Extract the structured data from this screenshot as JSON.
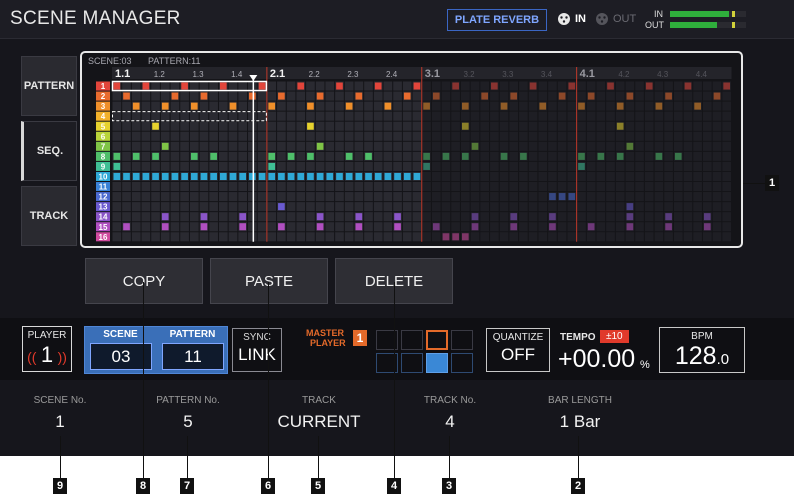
{
  "header": {
    "title": "SCENE MANAGER",
    "fx_label": "PLATE REVERB",
    "in_label": "IN",
    "out_label": "OUT",
    "meter_in_label": "IN",
    "meter_out_label": "OUT",
    "meter_in_level": 0.78,
    "meter_out_level": 0.62
  },
  "tabs": [
    {
      "label": "PATTERN",
      "active": false
    },
    {
      "label": "SEQ.",
      "active": true
    },
    {
      "label": "TRACK",
      "active": false
    }
  ],
  "grid": {
    "info_scene": "SCENE:03",
    "info_pattern": "PATTERN:11",
    "beat_labels": [
      "1.1",
      "1.2",
      "1.3",
      "1.4",
      "2.1",
      "2.2",
      "2.3",
      "2.4",
      "3.1",
      "3.2",
      "3.3",
      "3.4",
      "4.1",
      "4.2",
      "4.3",
      "4.4"
    ],
    "track_numbers": [
      "1",
      "2",
      "3",
      "4",
      "5",
      "6",
      "7",
      "8",
      "9",
      "10",
      "11",
      "12",
      "13",
      "14",
      "15",
      "16"
    ],
    "track_colors": [
      "#e2453b",
      "#e86b2e",
      "#ef8f2a",
      "#f2b12a",
      "#e6d22e",
      "#b9d43a",
      "#7fc446",
      "#4fbf6a",
      "#3fbf95",
      "#2fa9d6",
      "#3a82d6",
      "#4b6ad0",
      "#6a5ad0",
      "#8a55c8",
      "#b04fc0",
      "#d04a9e"
    ],
    "playhead_step": 13,
    "steps": {
      "1": [
        0,
        3,
        7,
        11,
        15,
        19,
        23,
        27,
        31,
        35,
        39,
        43,
        47,
        51,
        55,
        59,
        63
      ],
      "2": [
        1,
        6,
        9,
        14,
        17,
        21,
        25,
        30,
        33,
        38,
        41,
        46,
        49,
        53,
        57,
        62
      ],
      "3": [
        2,
        5,
        8,
        12,
        16,
        20,
        24,
        28,
        32,
        36,
        40,
        44,
        48,
        52,
        56,
        60
      ],
      "4": [],
      "5": [
        4,
        20,
        36,
        52
      ],
      "6": [],
      "7": [
        5,
        21,
        37,
        53
      ],
      "8": [
        0,
        2,
        4,
        8,
        10,
        16,
        18,
        20,
        24,
        26,
        32,
        34,
        36,
        40,
        42,
        48,
        50,
        52,
        56,
        58
      ],
      "9": [
        0,
        16,
        32,
        48
      ],
      "10": [
        0,
        1,
        2,
        3,
        4,
        5,
        6,
        7,
        8,
        9,
        10,
        11,
        12,
        13,
        14,
        15,
        16,
        17,
        18,
        19,
        20,
        21,
        22,
        23,
        24,
        25,
        26,
        27,
        28,
        29,
        30,
        31
      ],
      "11": [],
      "12": [
        45,
        46,
        47
      ],
      "13": [
        17,
        53
      ],
      "14": [
        5,
        9,
        13,
        21,
        25,
        29,
        37,
        41,
        45,
        53,
        57,
        61
      ],
      "15": [
        1,
        5,
        9,
        13,
        17,
        21,
        25,
        29,
        33,
        37,
        41,
        45,
        49,
        53,
        57,
        61
      ],
      "16": [
        34,
        35,
        36
      ]
    },
    "sel_track_row": "1",
    "sel_dashed_row": "4"
  },
  "buttons": {
    "copy": "COPY",
    "paste": "PASTE",
    "delete": "DELETE"
  },
  "lower": {
    "player_label": "PLAYER",
    "player_value": "1",
    "scene_label": "SCENE",
    "scene_value": "03",
    "pattern_label": "PATTERN",
    "pattern_value": "11",
    "sync_label": "SYNC",
    "sync_value": "LINK",
    "master_label": "MASTER",
    "master_sub": "PLAYER",
    "master_num": "1",
    "quantize_label": "QUANTIZE",
    "quantize_value": "OFF",
    "tempo_label": "TEMPO",
    "tempo_range": "±10",
    "tempo_value": "+00.00",
    "tempo_unit": "%",
    "bpm_label": "BPM",
    "bpm_value": "128",
    "bpm_decimal": ".0"
  },
  "params": [
    {
      "label": "SCENE No.",
      "value": "1"
    },
    {
      "label": "PATTERN No.",
      "value": "5"
    },
    {
      "label": "TRACK",
      "value": "CURRENT"
    },
    {
      "label": "TRACK No.",
      "value": "4"
    },
    {
      "label": "BAR LENGTH",
      "value": "1 Bar"
    }
  ],
  "callouts": [
    "1",
    "2",
    "3",
    "4",
    "5",
    "6",
    "7",
    "8",
    "9"
  ]
}
